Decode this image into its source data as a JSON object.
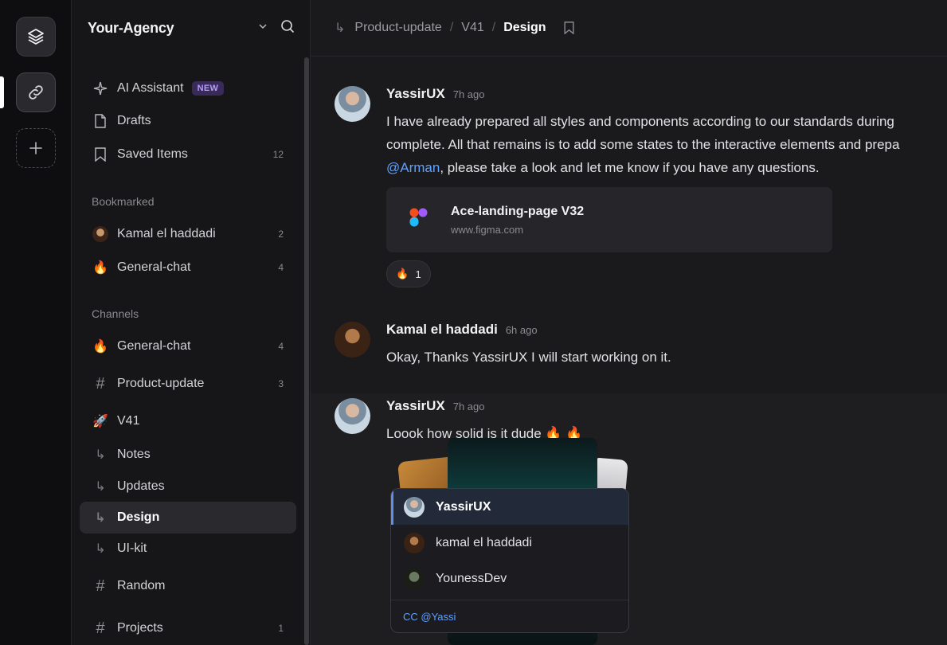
{
  "rail": {
    "logo_icon": "layers-icon",
    "active_icon": "link-icon",
    "add_icon": "plus-icon"
  },
  "sidebar": {
    "workspace": "Your-Agency",
    "top_items": [
      {
        "label": "AI Assistant",
        "icon": "sparkles-icon",
        "badge": "NEW"
      },
      {
        "label": "Drafts",
        "icon": "file-icon"
      },
      {
        "label": "Saved Items",
        "icon": "bookmark-icon",
        "count": "12"
      }
    ],
    "bookmarked_label": "Bookmarked",
    "bookmarked": [
      {
        "label": "Kamal el haddadi",
        "count": "2"
      },
      {
        "label": "General-chat",
        "count": "4"
      }
    ],
    "channels_label": "Channels",
    "channels": [
      {
        "label": "General-chat",
        "count": "4"
      },
      {
        "label": "Product-update",
        "count": "3"
      },
      {
        "label": "V41"
      },
      {
        "label": "Notes"
      },
      {
        "label": "Updates"
      },
      {
        "label": "Design"
      },
      {
        "label": "UI-kit"
      },
      {
        "label": "Random"
      },
      {
        "label": "Projects",
        "count": "1"
      }
    ]
  },
  "breadcrumb": {
    "items": [
      "Product-update",
      "V41",
      "Design"
    ],
    "separator": "/"
  },
  "messages": [
    {
      "author": "YassirUX",
      "time": "7h ago",
      "lines": [
        "I have already prepared all styles and components according to our standards during",
        "complete. All that remains is to add some states to the interactive elements and prepa"
      ],
      "mention": "@Arman",
      "line3_rest": ", please take a look and let me know if you have any questions.",
      "link_title": "Ace-landing-page V32",
      "link_url": "www.figma.com",
      "reaction_emoji": "🔥",
      "reaction_count": "1"
    },
    {
      "author": "Kamal el haddadi",
      "time": "6h ago",
      "text": "Okay, Thanks YassirUX I will start working on it."
    },
    {
      "author": "YassirUX",
      "time": "7h ago",
      "text": "Loook how solid is it dude 🔥 🔥"
    }
  ],
  "mention_popup": {
    "items": [
      {
        "name": "YassirUX"
      },
      {
        "name": "kamal el haddadi"
      },
      {
        "name": "YounessDev"
      }
    ],
    "footer": "CC @Yassi"
  },
  "colors": {
    "accent": "#5ea0ff",
    "badge": "#b49cff",
    "fire": "#ff7a1a"
  }
}
